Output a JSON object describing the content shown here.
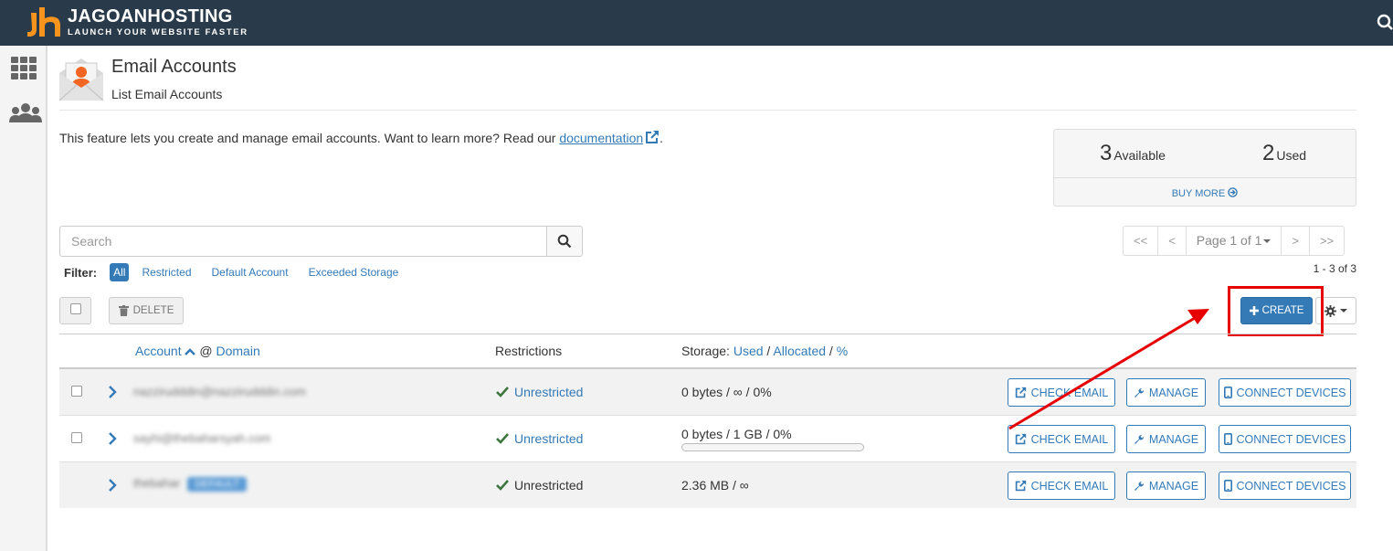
{
  "brand": {
    "name": "JAGOANHOSTING",
    "tagline": "LAUNCH YOUR WEBSITE FASTER",
    "accent": "#f7941d",
    "bar_color": "#293a4a"
  },
  "header": {
    "title": "Email Accounts",
    "subtitle": "List Email Accounts"
  },
  "intro": {
    "text": "This feature lets you create and manage email accounts. Want to learn more? Read our ",
    "link": "documentation",
    "suffix": "."
  },
  "stats": {
    "available_num": "3",
    "available_label": "Available",
    "used_num": "2",
    "used_label": "Used",
    "buy_more": "BUY MORE"
  },
  "search": {
    "placeholder": "Search"
  },
  "pagination": {
    "first": "<<",
    "prev": "<",
    "page": "Page 1 of 1",
    "next": ">",
    "last": ">>",
    "count": "1 - 3 of 3"
  },
  "filter": {
    "label": "Filter:",
    "options": [
      "All",
      "Restricted",
      "Default Account",
      "Exceeded Storage"
    ],
    "active": "All"
  },
  "toolbar": {
    "delete": "DELETE",
    "create": "CREATE"
  },
  "columns": {
    "account": "Account",
    "at": "@",
    "domain": "Domain",
    "restrictions": "Restrictions",
    "storage_prefix": "Storage:",
    "used": "Used",
    "sep1": "/",
    "allocated": "Allocated",
    "sep2": "/",
    "percent": "%"
  },
  "rows": [
    {
      "account": "nazzirudddin@nazzirudddin.com",
      "restriction": "Unrestricted",
      "storage": "0 bytes / ∞ / 0%",
      "usage_fraction": null
    },
    {
      "account": "sayhi@thebaharsyah.com",
      "restriction": "Unrestricted",
      "storage": "0 bytes / 1 GB / 0%",
      "usage_fraction": 0
    },
    {
      "account": "thebahar",
      "tag": "DEFAULT",
      "restriction": "Unrestricted",
      "storage": "2.36 MB / ∞"
    }
  ],
  "actions": {
    "check_email": "CHECK EMAIL",
    "manage": "MANAGE",
    "connect": "CONNECT DEVICES"
  },
  "icons": [
    "grid-icon",
    "users-icon",
    "search-icon",
    "envelope-icon",
    "external-link-icon",
    "trash-icon",
    "plus-icon",
    "gear-icon",
    "chevron-right-icon",
    "check-icon",
    "wrench-icon",
    "mobile-icon",
    "arrow-circle-right-icon"
  ],
  "colors": {
    "primary": "#337ab7",
    "success": "#3c763d",
    "annotation": "#e60000"
  }
}
